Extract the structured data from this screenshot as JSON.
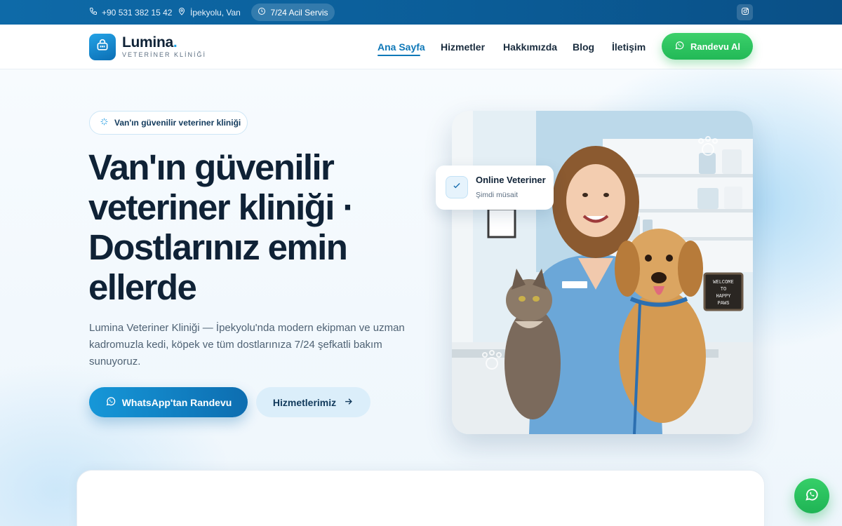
{
  "topbar": {
    "phone": "+90 531 382 15 42",
    "location": "İpekyolu, Van",
    "emergency": "7/24 Acil Servis",
    "social_icon": "instagram-icon"
  },
  "brand": {
    "name": "Lumina",
    "dot": ".",
    "tagline": "VETERİNER KLİNİĞİ",
    "icon": "pet-carrier-icon"
  },
  "nav": {
    "links": [
      "Ana Sayfa",
      "Hizmetler",
      "Hakkımızda",
      "Blog",
      "İletişim"
    ],
    "active_index": 0,
    "cta": "Randevu Al"
  },
  "hero": {
    "badge": "Van'ın güvenilir veteriner kliniği",
    "headline_lines": [
      "Van'ın güvenilir",
      "veteriner kliniği ·",
      "Dostlarınız emin",
      "ellerde"
    ],
    "lead": "Lumina Veteriner Kliniği — İpekyolu'nda modern ekipman ve uzman kadromuzla kedi, köpek ve tüm dostlarınıza 7/24 şefkatli bakım sunuyoruz.",
    "primary_cta": "WhatsApp'tan Randevu",
    "secondary_cta": "Hizmetlerimiz"
  },
  "status_card": {
    "title": "Online Veteriner",
    "subtitle": "Şimdi müsait"
  },
  "photo": {
    "sign_lines": [
      "WELCOME",
      "TO",
      "HAPPY",
      "PAWS"
    ]
  },
  "colors": {
    "primary": "#0d6db0",
    "accent": "#1aa0e3",
    "whatsapp": "#22b957",
    "topbar": "#0b5d98",
    "heading": "#0f2236"
  }
}
